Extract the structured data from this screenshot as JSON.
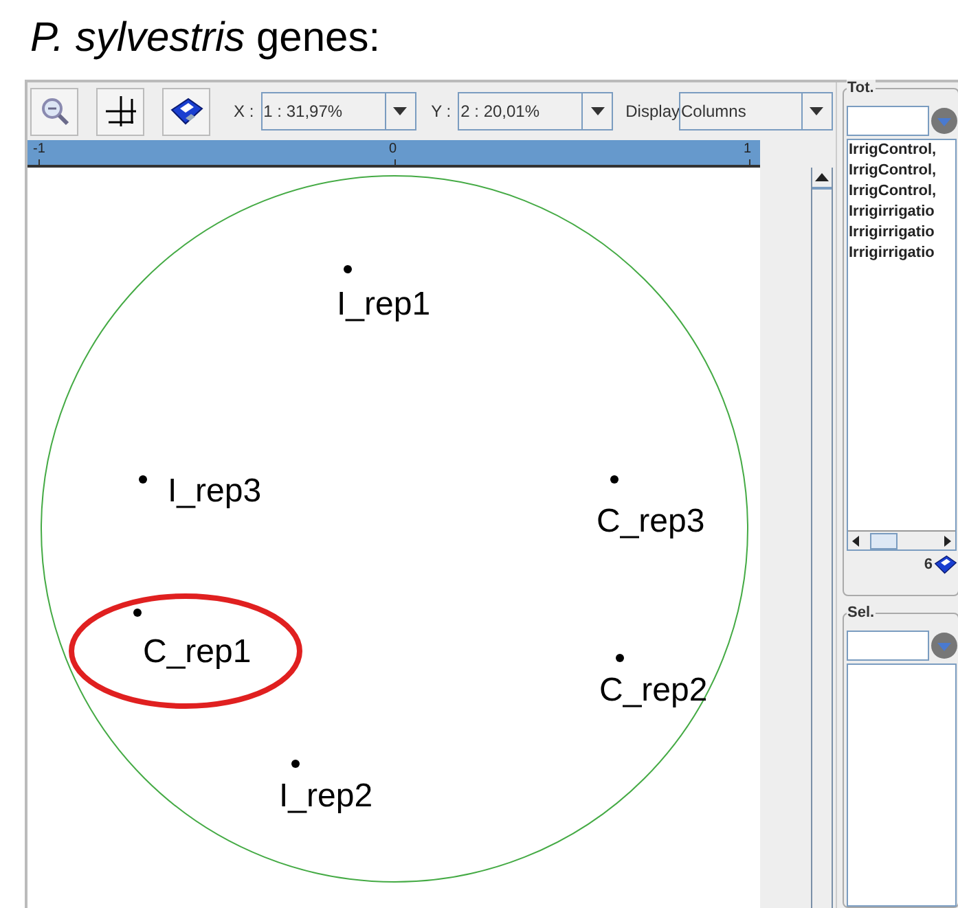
{
  "slide_title": "*P. sylvestris* genes:",
  "toolbar": {
    "x_label": "X :",
    "x_value": "1 : 31,97%",
    "y_label": "Y :",
    "y_value": "2 : 20,01%",
    "display_label": "Display",
    "display_value": "Columns"
  },
  "ruler": {
    "ticks": [
      "-1",
      "0",
      "1"
    ]
  },
  "points": [
    {
      "label": "I_rep1",
      "highlighted": false
    },
    {
      "label": "I_rep3",
      "highlighted": false
    },
    {
      "label": "C_rep3",
      "highlighted": false
    },
    {
      "label": "C_rep1",
      "highlighted": true
    },
    {
      "label": "C_rep2",
      "highlighted": false
    },
    {
      "label": "I_rep2",
      "highlighted": false
    }
  ],
  "tot_panel": {
    "title": "Tot.",
    "items": [
      "IrrigControl,",
      "IrrigControl,",
      "IrrigControl,",
      "Irrigirrigatio",
      "Irrigirrigatio",
      "Irrigirrigatio"
    ],
    "count": "6"
  },
  "sel_panel": {
    "title": "Sel."
  }
}
